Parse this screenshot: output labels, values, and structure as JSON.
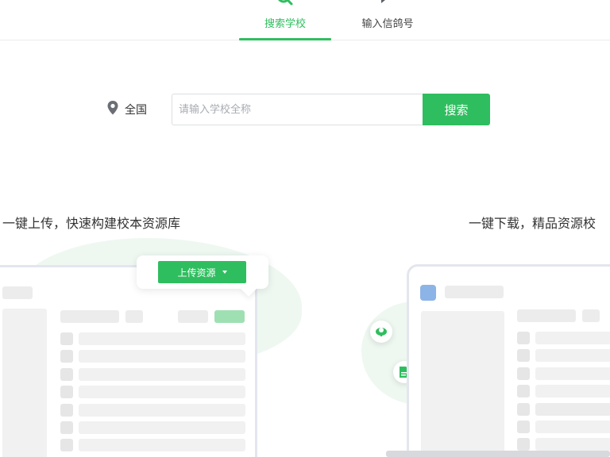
{
  "tabs": {
    "search_school": "搜索学校",
    "enter_code": "输入信鸽号"
  },
  "search": {
    "region": "全国",
    "placeholder": "请输入学校全称",
    "button": "搜索"
  },
  "features": {
    "left_caption": "一键上传，快速构建校本资源库",
    "right_caption": "一键下载，精品资源校",
    "upload_button": "上传资源"
  },
  "colors": {
    "accent": "#2fbe5f",
    "blue_square": "#8db4e6"
  },
  "icons": {
    "search_tab": "search-icon",
    "code_tab": "chat-icon",
    "region": "location-pin-icon"
  }
}
